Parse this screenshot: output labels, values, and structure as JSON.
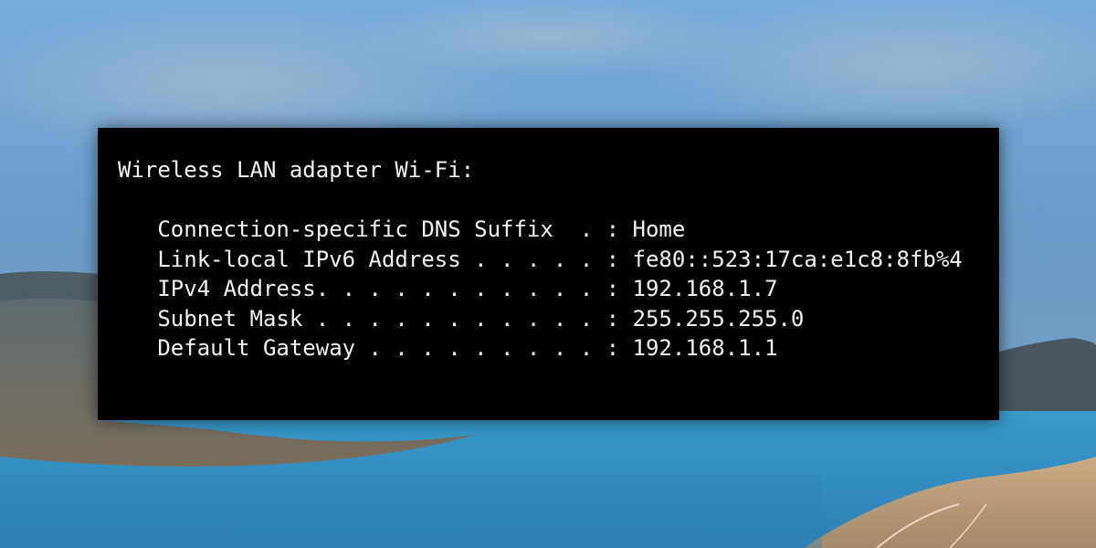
{
  "console": {
    "lines": {
      "header": "Wireless LAN adapter Wi-Fi:",
      "dns_suffix": "   Connection-specific DNS Suffix  . : Home",
      "ipv6": "   Link-local IPv6 Address . . . . . : fe80::523:17ca:e1c8:8fb%4",
      "ipv4": "   IPv4 Address. . . . . . . . . . . : 192.168.1.7",
      "subnet": "   Subnet Mask . . . . . . . . . . . : 255.255.255.0",
      "gateway": "   Default Gateway . . . . . . . . . : 192.168.1.1"
    }
  },
  "colors": {
    "console_bg": "#000000",
    "console_text": "#f2f2f2",
    "sky_top": "#6fa7e0",
    "lake": "#3f8fc0"
  }
}
